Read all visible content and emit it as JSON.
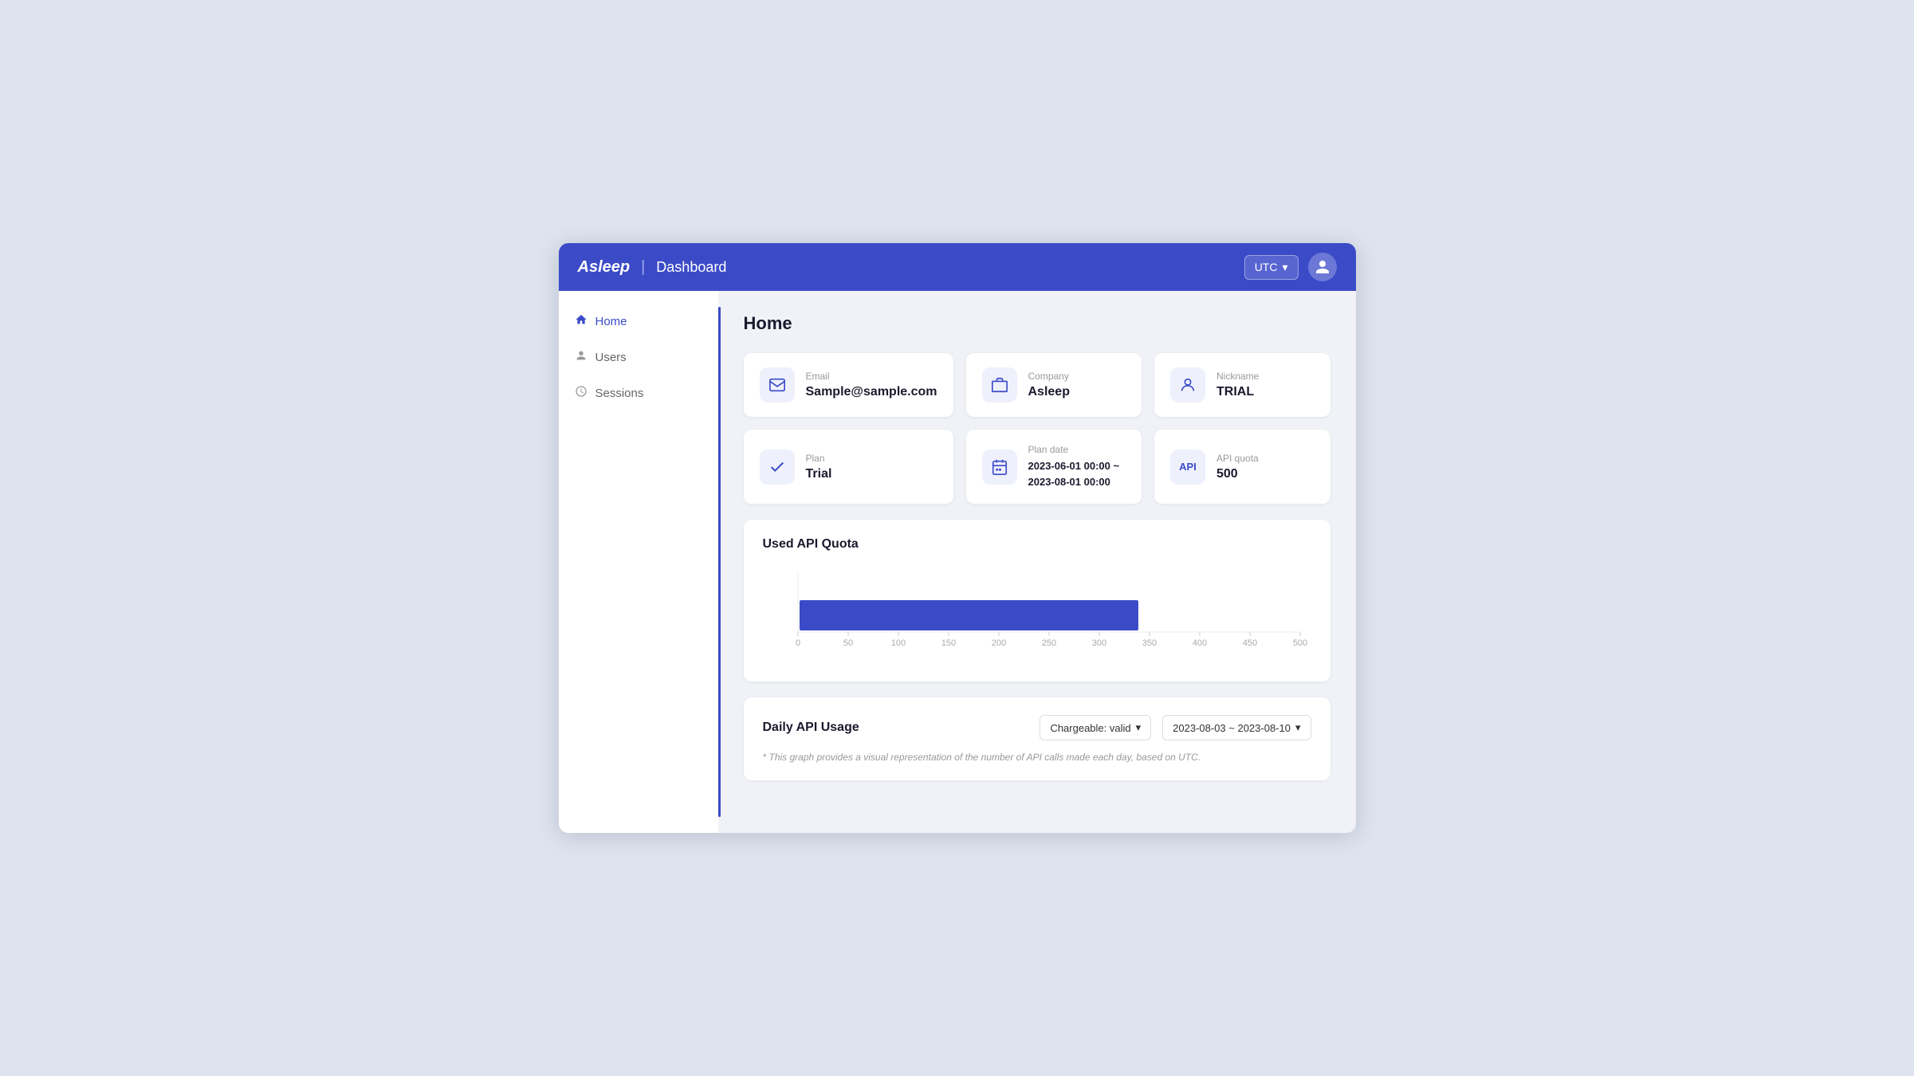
{
  "header": {
    "logo": "Asleep",
    "divider": "|",
    "title": "Dashboard",
    "timezone": "UTC",
    "timezone_arrow": "▾"
  },
  "sidebar": {
    "items": [
      {
        "id": "home",
        "label": "Home",
        "icon": "🏠",
        "active": true
      },
      {
        "id": "users",
        "label": "Users",
        "icon": "👤",
        "active": false
      },
      {
        "id": "sessions",
        "label": "Sessions",
        "icon": "⏱",
        "active": false
      }
    ]
  },
  "main": {
    "page_title": "Home",
    "info_cards": [
      {
        "id": "email",
        "label": "Email",
        "value": "Sample@sample.com",
        "icon_type": "email"
      },
      {
        "id": "company",
        "label": "Company",
        "value": "Asleep",
        "icon_type": "company"
      },
      {
        "id": "nickname",
        "label": "Nickname",
        "value": "TRIAL",
        "icon_type": "person"
      },
      {
        "id": "plan",
        "label": "Plan",
        "value": "Trial",
        "icon_type": "check"
      },
      {
        "id": "plan_date",
        "label": "Plan date",
        "value": "2023-06-01 00:00 ~\n2023-08-01 00:00",
        "value_line1": "2023-06-01 00:00 ~",
        "value_line2": "2023-08-01 00:00",
        "icon_type": "calendar"
      },
      {
        "id": "api_quota",
        "label": "API quota",
        "value": "500",
        "icon_type": "api"
      }
    ],
    "chart": {
      "title": "Used API Quota",
      "bar_value": 340,
      "bar_max": 500,
      "x_labels": [
        "0",
        "50",
        "100",
        "150",
        "200",
        "250",
        "300",
        "350",
        "400",
        "450",
        "500"
      ]
    },
    "daily_section": {
      "title": "Daily API Usage",
      "filter_label": "Chargeable: valid",
      "date_range": "2023-08-03 ~ 2023-08-10",
      "note": "* This graph provides a visual representation of the number of API calls made each day, based on UTC."
    }
  }
}
